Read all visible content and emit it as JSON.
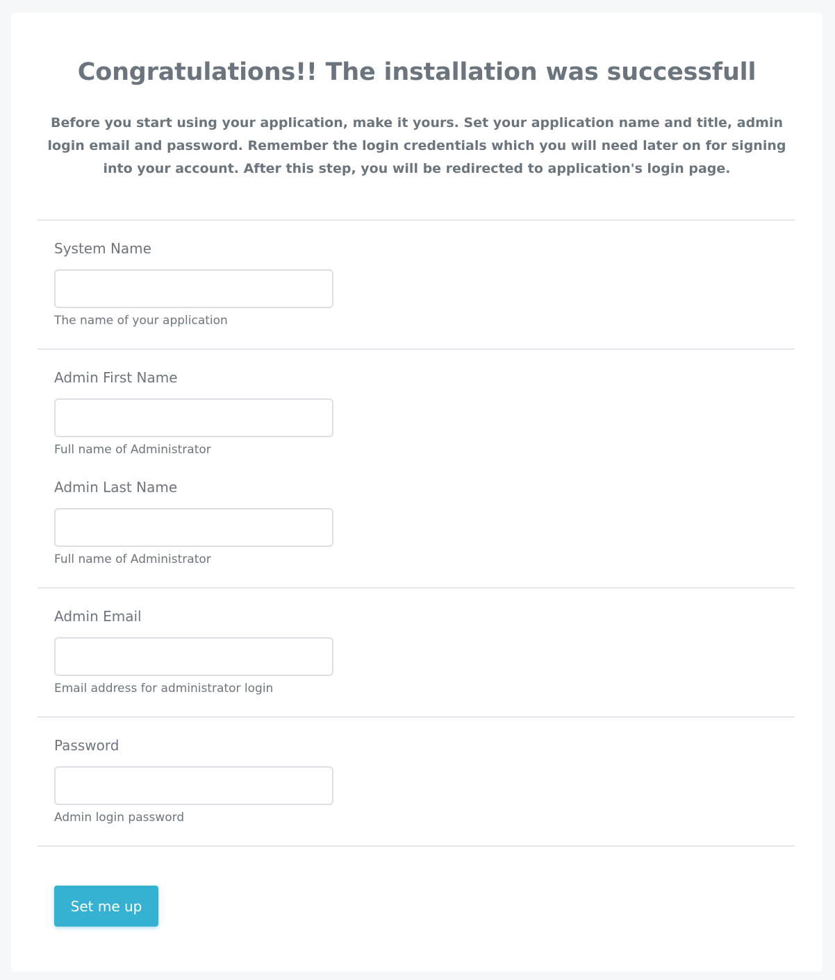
{
  "header": {
    "title": "Congratulations!! The installation was successfull",
    "intro": "Before you start using your application, make it yours. Set your application name and title, admin login email and password. Remember the login credentials which you will need later on for signing into your account. After this step, you will be redirected to application's login page."
  },
  "form": {
    "system_name": {
      "label": "System Name",
      "value": "",
      "help": "The name of your application"
    },
    "admin_first_name": {
      "label": "Admin First Name",
      "value": "",
      "help": "Full name of Administrator"
    },
    "admin_last_name": {
      "label": "Admin Last Name",
      "value": "",
      "help": "Full name of Administrator"
    },
    "admin_email": {
      "label": "Admin Email",
      "value": "",
      "help": "Email address for administrator login"
    },
    "password": {
      "label": "Password",
      "value": "",
      "help": "Admin login password"
    },
    "submit_label": "Set me up"
  },
  "colors": {
    "page_background": "#f5f7fb",
    "card_background": "#ffffff",
    "text": "#6c757d",
    "accent": "#36b1d2",
    "divider": "#e3e6ea"
  }
}
